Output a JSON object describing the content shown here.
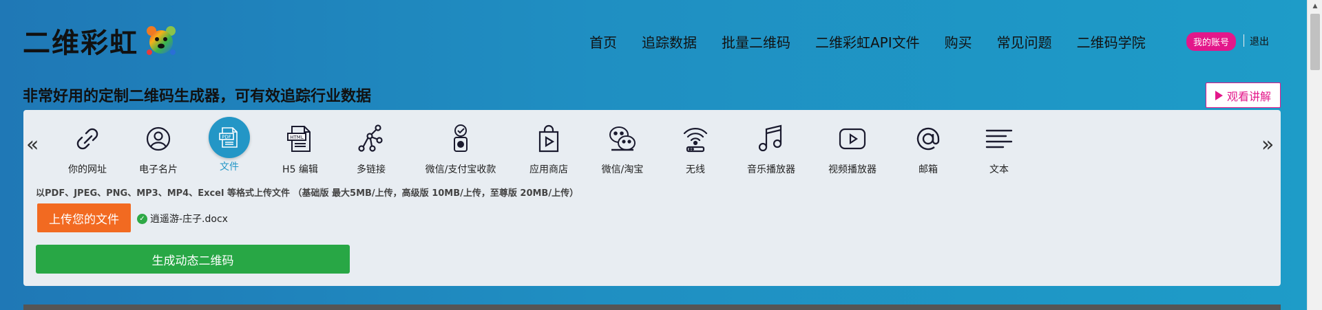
{
  "header": {
    "logo_text": "二维彩虹",
    "nav": [
      "首页",
      "追踪数据",
      "批量二维码",
      "二维彩虹API文件",
      "购买",
      "常见问题",
      "二维码学院"
    ],
    "account_label": "我的账号",
    "logout_label": "退出"
  },
  "subtitle": "非常好用的定制二维码生成器，可有效追踪行业数据",
  "watch_button": "观看讲解",
  "panel": {
    "arrow_left": "«",
    "arrow_right": "»",
    "types": [
      {
        "label": "你的网址",
        "icon": "link-icon"
      },
      {
        "label": "电子名片",
        "icon": "user-icon"
      },
      {
        "label": "文件",
        "icon": "pdf-file-icon",
        "active": true
      },
      {
        "label": "H5 编辑",
        "icon": "html-file-icon"
      },
      {
        "label": "多链接",
        "icon": "multi-link-icon"
      },
      {
        "label": "微信/支付宝收款",
        "icon": "payment-icon"
      },
      {
        "label": "应用商店",
        "icon": "app-store-icon"
      },
      {
        "label": "微信/淘宝",
        "icon": "wechat-icon"
      },
      {
        "label": "无线",
        "icon": "wifi-icon"
      },
      {
        "label": "音乐播放器",
        "icon": "music-icon"
      },
      {
        "label": "视频播放器",
        "icon": "video-icon"
      },
      {
        "label": "邮箱",
        "icon": "email-icon"
      },
      {
        "label": "文本",
        "icon": "text-icon"
      }
    ],
    "pdf_icon_label": "PDF",
    "html_icon_label": "HTML",
    "hint": "以PDF、JPEG、PNG、MP3、MP4、Excel 等格式上传文件 （基础版 最大5MB/上传，高级版 10MB/上传，至尊版 20MB/上传）",
    "upload_button": "上传您的文件",
    "file_name": "逍遥游-庄子.docx",
    "generate_button": "生成动态二维码"
  },
  "colors": {
    "accent_pink": "#e3178a",
    "upload_orange": "#f26a21",
    "generate_green": "#28a745",
    "active_blue": "#2396c6"
  }
}
